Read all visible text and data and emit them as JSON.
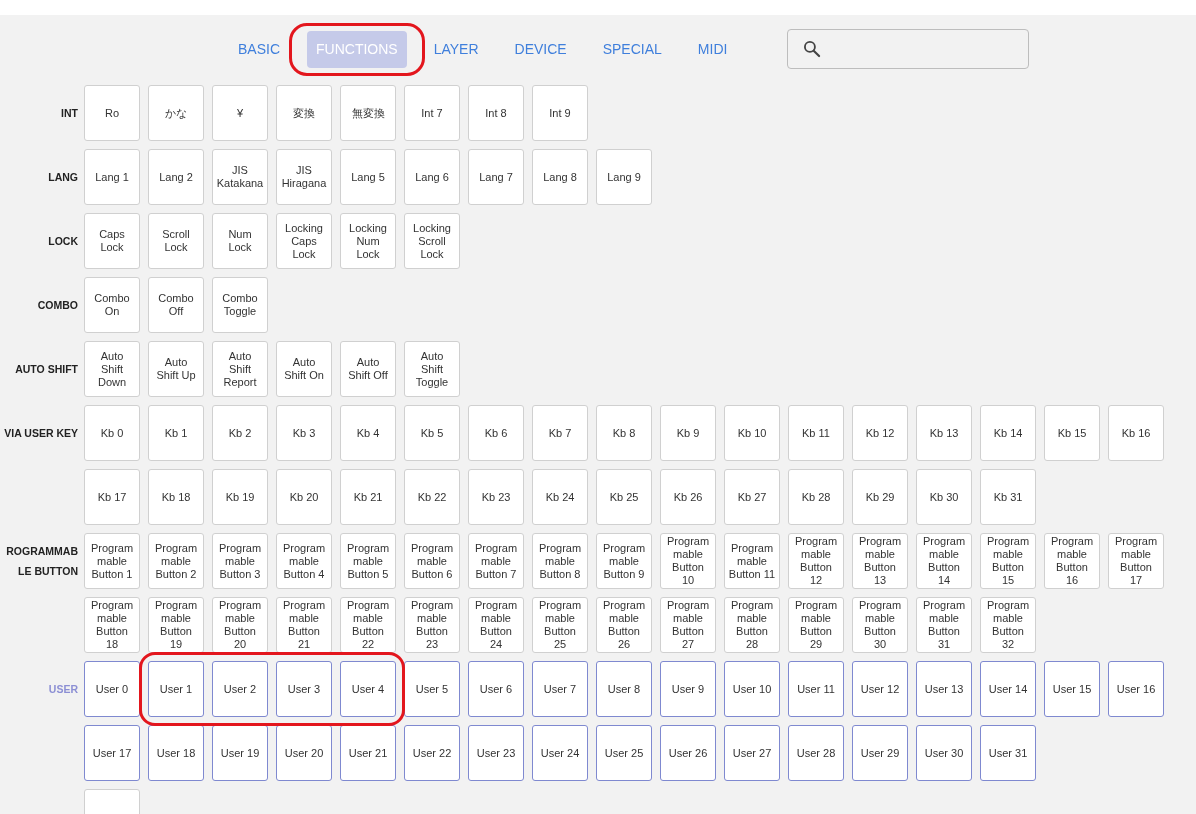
{
  "tabs": [
    {
      "label": "BASIC",
      "selected": false,
      "circled": false
    },
    {
      "label": "FUNCTIONS",
      "selected": true,
      "circled": true
    },
    {
      "label": "LAYER",
      "selected": false,
      "circled": false
    },
    {
      "label": "DEVICE",
      "selected": false,
      "circled": false
    },
    {
      "label": "SPECIAL",
      "selected": false,
      "circled": false
    },
    {
      "label": "MIDI",
      "selected": false,
      "circled": false
    }
  ],
  "groups": [
    {
      "label": "INT",
      "kind": "plain",
      "rows": [
        [
          {
            "label": "Ro"
          },
          {
            "label": "かな"
          },
          {
            "label": "¥"
          },
          {
            "label": "変換"
          },
          {
            "label": "無変換"
          },
          {
            "label": "Int 7"
          },
          {
            "label": "Int 8"
          },
          {
            "label": "Int 9"
          }
        ]
      ]
    },
    {
      "label": "LANG",
      "kind": "plain",
      "rows": [
        [
          {
            "label": "Lang 1"
          },
          {
            "label": "Lang 2"
          },
          {
            "label": "JIS Katakana"
          },
          {
            "label": "JIS Hiragana"
          },
          {
            "label": "Lang 5"
          },
          {
            "label": "Lang 6"
          },
          {
            "label": "Lang 7"
          },
          {
            "label": "Lang 8"
          },
          {
            "label": "Lang 9"
          }
        ]
      ]
    },
    {
      "label": "LOCK",
      "kind": "plain",
      "rows": [
        [
          {
            "label": "Caps Lock"
          },
          {
            "label": "Scroll Lock"
          },
          {
            "label": "Num Lock"
          },
          {
            "label": "Locking Caps Lock"
          },
          {
            "label": "Locking Num Lock"
          },
          {
            "label": "Locking Scroll Lock"
          }
        ]
      ]
    },
    {
      "label": "COMBO",
      "kind": "plain",
      "rows": [
        [
          {
            "label": "Combo On"
          },
          {
            "label": "Combo Off"
          },
          {
            "label": "Combo Toggle"
          }
        ]
      ]
    },
    {
      "label": "AUTO SHIFT",
      "kind": "plain",
      "rows": [
        [
          {
            "label": "Auto Shift Down"
          },
          {
            "label": "Auto Shift Up"
          },
          {
            "label": "Auto Shift Report"
          },
          {
            "label": "Auto Shift On"
          },
          {
            "label": "Auto Shift Off"
          },
          {
            "label": "Auto Shift Toggle"
          }
        ]
      ]
    },
    {
      "label": "VIA USER KEY",
      "kind": "plain",
      "rows": [
        [
          {
            "label": "Kb 0"
          },
          {
            "label": "Kb 1"
          },
          {
            "label": "Kb 2"
          },
          {
            "label": "Kb 3"
          },
          {
            "label": "Kb 4"
          },
          {
            "label": "Kb 5"
          },
          {
            "label": "Kb 6"
          },
          {
            "label": "Kb 7"
          },
          {
            "label": "Kb 8"
          },
          {
            "label": "Kb 9"
          },
          {
            "label": "Kb 10"
          },
          {
            "label": "Kb 11"
          },
          {
            "label": "Kb 12"
          },
          {
            "label": "Kb 13"
          },
          {
            "label": "Kb 14"
          },
          {
            "label": "Kb 15"
          },
          {
            "label": "Kb 16"
          }
        ],
        [
          {
            "label": "Kb 17"
          },
          {
            "label": "Kb 18"
          },
          {
            "label": "Kb 19"
          },
          {
            "label": "Kb 20"
          },
          {
            "label": "Kb 21"
          },
          {
            "label": "Kb 22"
          },
          {
            "label": "Kb 23"
          },
          {
            "label": "Kb 24"
          },
          {
            "label": "Kb 25"
          },
          {
            "label": "Kb 26"
          },
          {
            "label": "Kb 27"
          },
          {
            "label": "Kb 28"
          },
          {
            "label": "Kb 29"
          },
          {
            "label": "Kb 30"
          },
          {
            "label": "Kb 31"
          }
        ]
      ]
    },
    {
      "label": "ROGRAMMABLE BUTTON",
      "kind": "plain",
      "rows": [
        [
          {
            "label": "Programmable Button 1"
          },
          {
            "label": "Programmable Button 2"
          },
          {
            "label": "Programmable Button 3"
          },
          {
            "label": "Programmable Button 4"
          },
          {
            "label": "Programmable Button 5"
          },
          {
            "label": "Programmable Button 6"
          },
          {
            "label": "Programmable Button 7"
          },
          {
            "label": "Programmable Button 8"
          },
          {
            "label": "Programmable Button 9"
          },
          {
            "label": "Programmable Button 10"
          },
          {
            "label": "Programmable Button 11"
          },
          {
            "label": "Programmable Button 12"
          },
          {
            "label": "Programmable Button 13"
          },
          {
            "label": "Programmable Button 14"
          },
          {
            "label": "Programmable Button 15"
          },
          {
            "label": "Programmable Button 16"
          },
          {
            "label": "Programmable Button 17"
          }
        ],
        [
          {
            "label": "Programmable Button 18"
          },
          {
            "label": "Programmable Button 19"
          },
          {
            "label": "Programmable Button 20"
          },
          {
            "label": "Programmable Button 21"
          },
          {
            "label": "Programmable Button 22"
          },
          {
            "label": "Programmable Button 23"
          },
          {
            "label": "Programmable Button 24"
          },
          {
            "label": "Programmable Button 25"
          },
          {
            "label": "Programmable Button 26"
          },
          {
            "label": "Programmable Button 27"
          },
          {
            "label": "Programmable Button 28"
          },
          {
            "label": "Programmable Button 29"
          },
          {
            "label": "Programmable Button 30"
          },
          {
            "label": "Programmable Button 31"
          },
          {
            "label": "Programmable Button 32"
          }
        ]
      ]
    },
    {
      "label": "USER",
      "kind": "user",
      "rows": [
        [
          {
            "label": "User 0",
            "circled": false
          },
          {
            "label": "User 1",
            "circled": true
          },
          {
            "label": "User 2",
            "circled": true
          },
          {
            "label": "User 3",
            "circled": true
          },
          {
            "label": "User 4",
            "circled": true
          },
          {
            "label": "User 5",
            "circled": false
          },
          {
            "label": "User 6",
            "circled": false
          },
          {
            "label": "User 7",
            "circled": false
          },
          {
            "label": "User 8",
            "circled": false
          },
          {
            "label": "User 9",
            "circled": false
          },
          {
            "label": "User 10",
            "circled": false
          },
          {
            "label": "User 11",
            "circled": false
          },
          {
            "label": "User 12",
            "circled": false
          },
          {
            "label": "User 13",
            "circled": false
          },
          {
            "label": "User 14",
            "circled": false
          },
          {
            "label": "User 15",
            "circled": false
          },
          {
            "label": "User 16",
            "circled": false
          }
        ],
        [
          {
            "label": "User 17",
            "circled": false
          },
          {
            "label": "User 18",
            "circled": false
          },
          {
            "label": "User 19",
            "circled": false
          },
          {
            "label": "User 20",
            "circled": false
          },
          {
            "label": "User 21",
            "circled": false
          },
          {
            "label": "User 22",
            "circled": false
          },
          {
            "label": "User 23",
            "circled": false
          },
          {
            "label": "User 24",
            "circled": false
          },
          {
            "label": "User 25",
            "circled": false
          },
          {
            "label": "User 26",
            "circled": false
          },
          {
            "label": "User 27",
            "circled": false
          },
          {
            "label": "User 28",
            "circled": false
          },
          {
            "label": "User 29",
            "circled": false
          },
          {
            "label": "User 30",
            "circled": false
          },
          {
            "label": "User 31",
            "circled": false
          }
        ]
      ]
    },
    {
      "kind": "plain",
      "rows": [
        [
          {}
        ]
      ]
    }
  ]
}
